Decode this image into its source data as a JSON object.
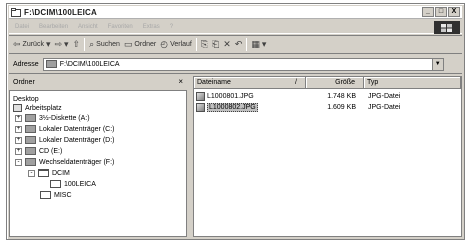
{
  "window": {
    "title": "F:\\DCIM\\100LEICA",
    "minimize": "_",
    "maximize": "□",
    "close": "X"
  },
  "menu": {
    "items": [
      "Datei",
      "Bearbeiten",
      "Ansicht",
      "Favoriten",
      "Extras",
      "?"
    ]
  },
  "toolbar": {
    "back": "Zurück",
    "search": "Suchen",
    "folders": "Ordner",
    "history": "Verlauf"
  },
  "address": {
    "label": "Adresse",
    "value": "F:\\DCIM\\100LEICA"
  },
  "folders_pane": {
    "header": "Ordner",
    "close": "×",
    "tree": [
      {
        "label": "Desktop",
        "expander": "",
        "icon": "desktop-icon"
      },
      {
        "label": "Arbeitsplatz",
        "expander": "",
        "icon": "computer-icon"
      },
      {
        "label": "3½-Diskette (A:)",
        "expander": "+",
        "icon": "floppy-icon"
      },
      {
        "label": "Lokaler Datenträger (C:)",
        "expander": "+",
        "icon": "drive-icon"
      },
      {
        "label": "Lokaler Datenträger (D:)",
        "expander": "+",
        "icon": "drive-icon"
      },
      {
        "label": "CD (E:)",
        "expander": "+",
        "icon": "cd-icon"
      },
      {
        "label": "Wechseldatenträger (F:)",
        "expander": "-",
        "icon": "removable-drive-icon"
      },
      {
        "label": "DCIM",
        "expander": "-",
        "icon": "folder-open-icon"
      },
      {
        "label": "100LEICA",
        "expander": "",
        "icon": "folder-icon"
      },
      {
        "label": "MISC",
        "expander": "",
        "icon": "folder-icon"
      }
    ]
  },
  "file_list": {
    "columns": {
      "name": "Dateiname",
      "sort": "/",
      "size": "Größe",
      "type": "Typ"
    },
    "files": [
      {
        "name": "L1000801.JPG",
        "size": "1.748 KB",
        "type": "JPG-Datei",
        "selected": false
      },
      {
        "name": "L1000802.JPG",
        "size": "1.609 KB",
        "type": "JPG-Datei",
        "selected": true
      }
    ]
  }
}
